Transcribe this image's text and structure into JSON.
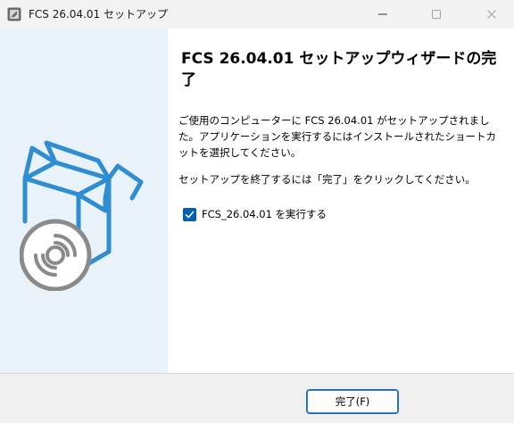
{
  "window": {
    "title": "FCS 26.04.01 セットアップ",
    "app_icon": "installer-icon",
    "controls": [
      "minimize-icon",
      "maximize-icon",
      "close-icon"
    ]
  },
  "side_panel": {
    "illustration": "box-with-disc-icon",
    "background": "#e9f2f9",
    "accent": "#2f8ed1"
  },
  "content": {
    "heading": "FCS 26.04.01 セットアップウィザードの完了",
    "description": "ご使用のコンピューターに FCS 26.04.01 がセットアップされました。アプリケーションを実行するにはインストールされたショートカットを選択してください。",
    "instruction": "セットアップを終了するには「完了」をクリックしてください。",
    "run_checkbox": {
      "label": "FCS_26.04.01 を実行する",
      "checked": true
    }
  },
  "footer": {
    "finish_label": "完了(F)"
  }
}
